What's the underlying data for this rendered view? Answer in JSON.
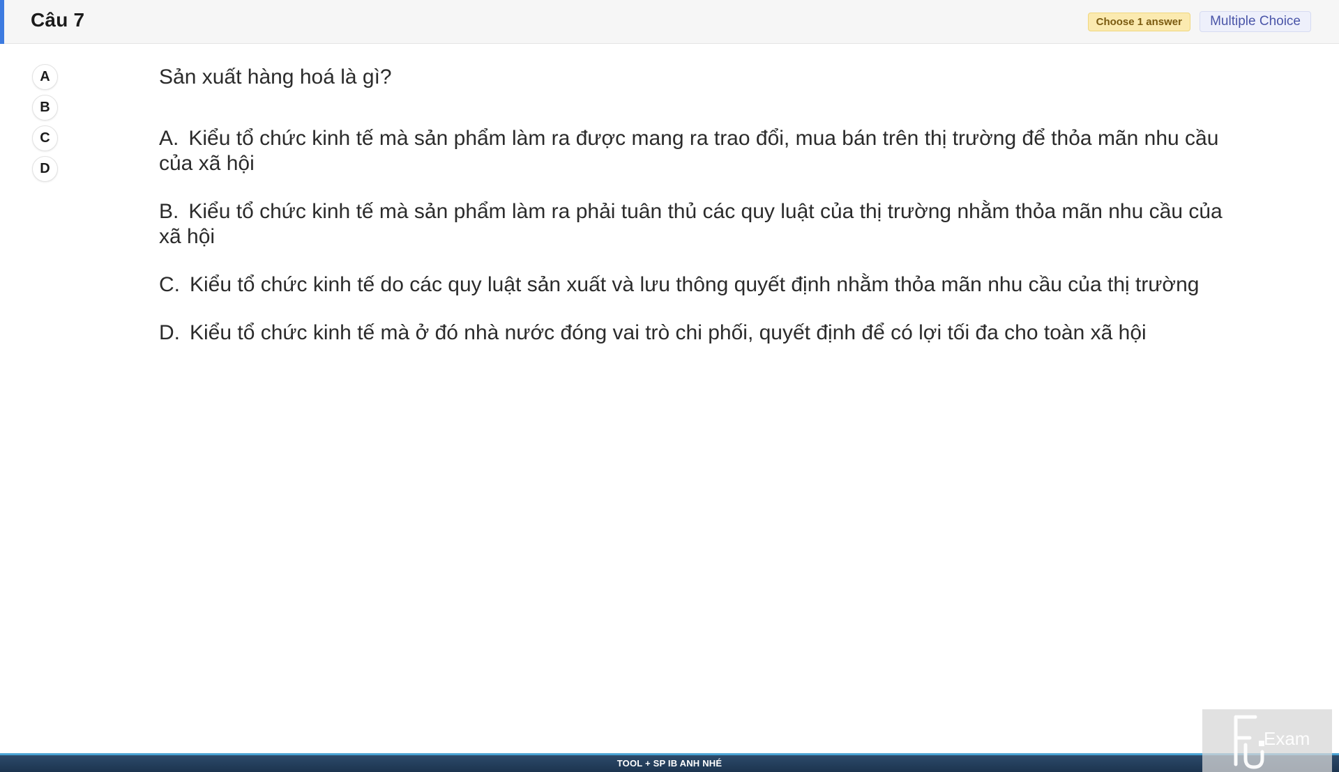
{
  "header": {
    "title": "Câu 7",
    "choose_badge": "Choose 1 answer",
    "type_badge": "Multiple Choice",
    "accent_color": "#3d7be0"
  },
  "options": [
    "A",
    "B",
    "C",
    "D"
  ],
  "question": {
    "text": "Sản xuất hàng hoá là gì?",
    "answers": [
      {
        "letter": "A.",
        "text": "Kiểu tổ chức kinh tế mà sản phẩm làm ra được mang ra trao đổi, mua bán trên thị trường để thỏa mãn nhu cầu của xã hội"
      },
      {
        "letter": "B.",
        "text": "Kiểu tổ chức kinh tế mà sản phẩm làm ra phải tuân thủ các quy luật của thị trường nhằm thỏa mãn nhu cầu của xã hội"
      },
      {
        "letter": "C.",
        "text": "Kiểu tổ chức kinh tế do các quy luật sản xuất và lưu thông quyết định nhằm thỏa mãn nhu cầu của thị trường"
      },
      {
        "letter": "D.",
        "text": "Kiểu tổ chức kinh tế mà ở đó nhà nước đóng vai trò chi phối, quyết định để có lợi tối đa cho toàn xã hội"
      }
    ]
  },
  "footer": {
    "text": "TOOL + SP IB ANH NHÉ"
  },
  "logo": {
    "icon": "fu-exam-logo",
    "text": "Exam"
  }
}
